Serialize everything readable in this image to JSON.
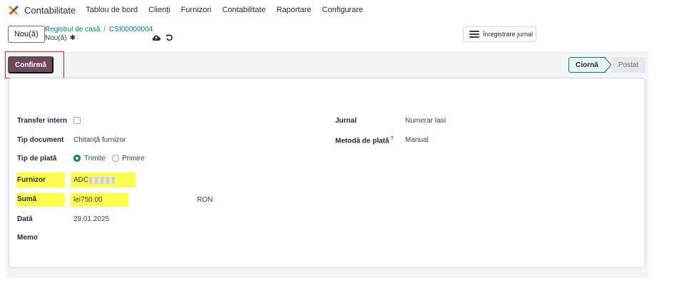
{
  "navbar": {
    "app_name": "Contabilitate",
    "items": [
      "Tablou de bord",
      "Clienți",
      "Furnizori",
      "Contabilitate",
      "Raportare",
      "Configurare"
    ]
  },
  "control": {
    "new_button": "Nou(ă)",
    "breadcrumb_parent": "Registrul de casă",
    "breadcrumb_sep": "/",
    "breadcrumb_current": "CSI00000004",
    "record_label": "Nou(ă)",
    "journal_button": "Înregistrare jurnal"
  },
  "statusbar": {
    "confirm_button": "Confirmă",
    "stages": [
      "Ciornă",
      "Postat"
    ],
    "active_stage": "Ciornă"
  },
  "form": {
    "left": {
      "internal_transfer_label": "Transfer intern",
      "document_type_label": "Tip document",
      "document_type_value": "Chitanță furnizor",
      "payment_type_label": "Tip de plată",
      "payment_options": [
        "Trimite",
        "Primire"
      ],
      "payment_selected": "Trimite",
      "supplier_label": "Furnizor",
      "supplier_value": "ADC",
      "amount_label": "Sumă",
      "amount_value": "lei750.00",
      "currency_value": "RON",
      "date_label": "Dată",
      "date_value": "29.01.2025",
      "memo_label": "Memo"
    },
    "right": {
      "journal_label": "Jurnal",
      "journal_value": "Numerar Iasi",
      "method_label": "Metodă de plată",
      "method_help": "?",
      "method_value": "Manual"
    }
  },
  "colors": {
    "brand": "#71475e",
    "accent": "#017e84",
    "highlight": "#ffff4d",
    "annotation": "#dc2626"
  }
}
